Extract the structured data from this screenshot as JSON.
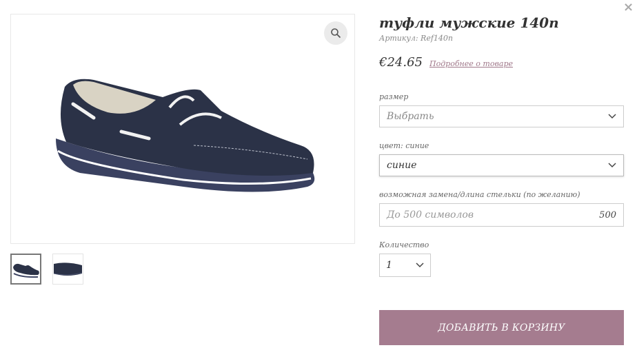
{
  "modal": {
    "close_glyph": "×"
  },
  "product": {
    "title": "туфли мужские 140п",
    "sku_label": "Артикул:",
    "sku_value": "Ref140n",
    "price": "€24.65",
    "more_link": "Подробнее о товаре"
  },
  "options": {
    "size": {
      "label": "размер",
      "value": "Выбрать"
    },
    "color": {
      "label": "цвет: синие",
      "value": "синие"
    },
    "insole": {
      "label": "возможная замена/длина стельки (по желанию)",
      "placeholder": "До 500 символов",
      "counter": "500"
    },
    "quantity": {
      "label": "Количество",
      "value": "1"
    }
  },
  "actions": {
    "add_to_cart": "ДОБАВИТЬ В КОРЗИНУ"
  },
  "gallery": {
    "thumbnail_count": 2,
    "active_thumbnail": 1
  },
  "icons": {
    "zoom": "magnifier-icon",
    "chevron": "chevron-down-icon",
    "close": "close-icon"
  },
  "colors": {
    "accent": "#a57c8f",
    "link": "#a0788a",
    "shoe_body": "#2b3247"
  }
}
